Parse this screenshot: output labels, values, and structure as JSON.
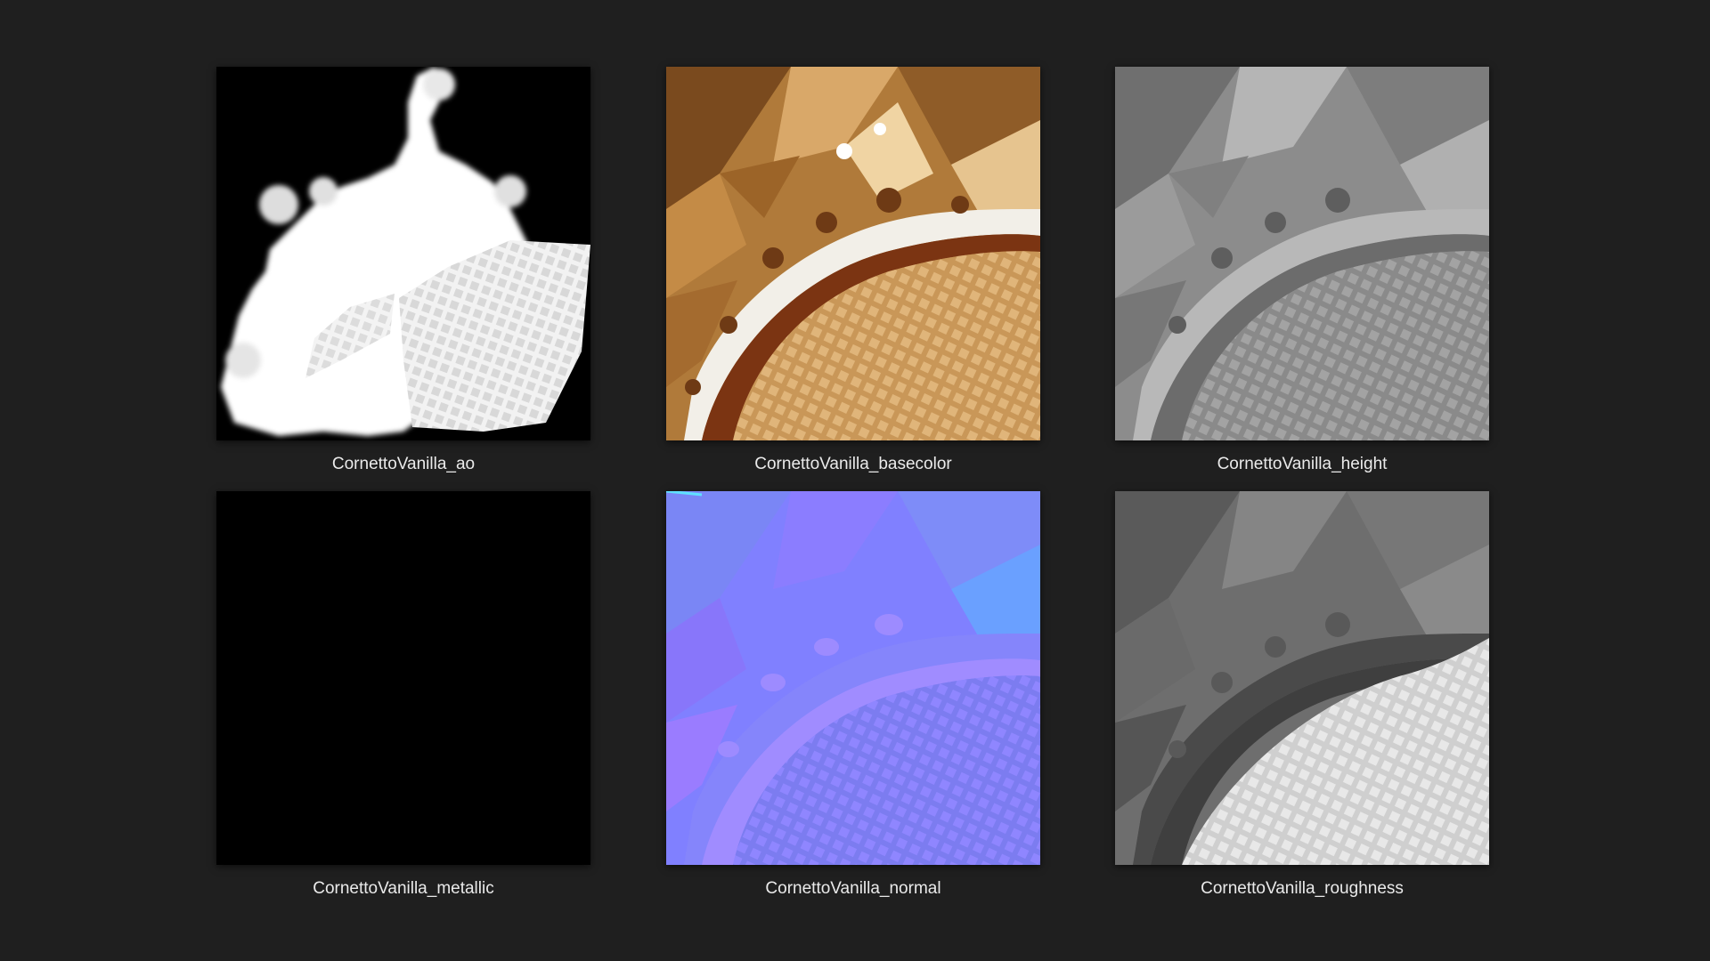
{
  "background_color": "#1f1f1f",
  "files": [
    {
      "name": "CornettoVanilla_ao",
      "map": "ao"
    },
    {
      "name": "CornettoVanilla_basecolor",
      "map": "basecolor"
    },
    {
      "name": "CornettoVanilla_height",
      "map": "height"
    },
    {
      "name": "CornettoVanilla_metallic",
      "map": "metallic"
    },
    {
      "name": "CornettoVanilla_normal",
      "map": "normal"
    },
    {
      "name": "CornettoVanilla_roughness",
      "map": "roughness"
    }
  ]
}
